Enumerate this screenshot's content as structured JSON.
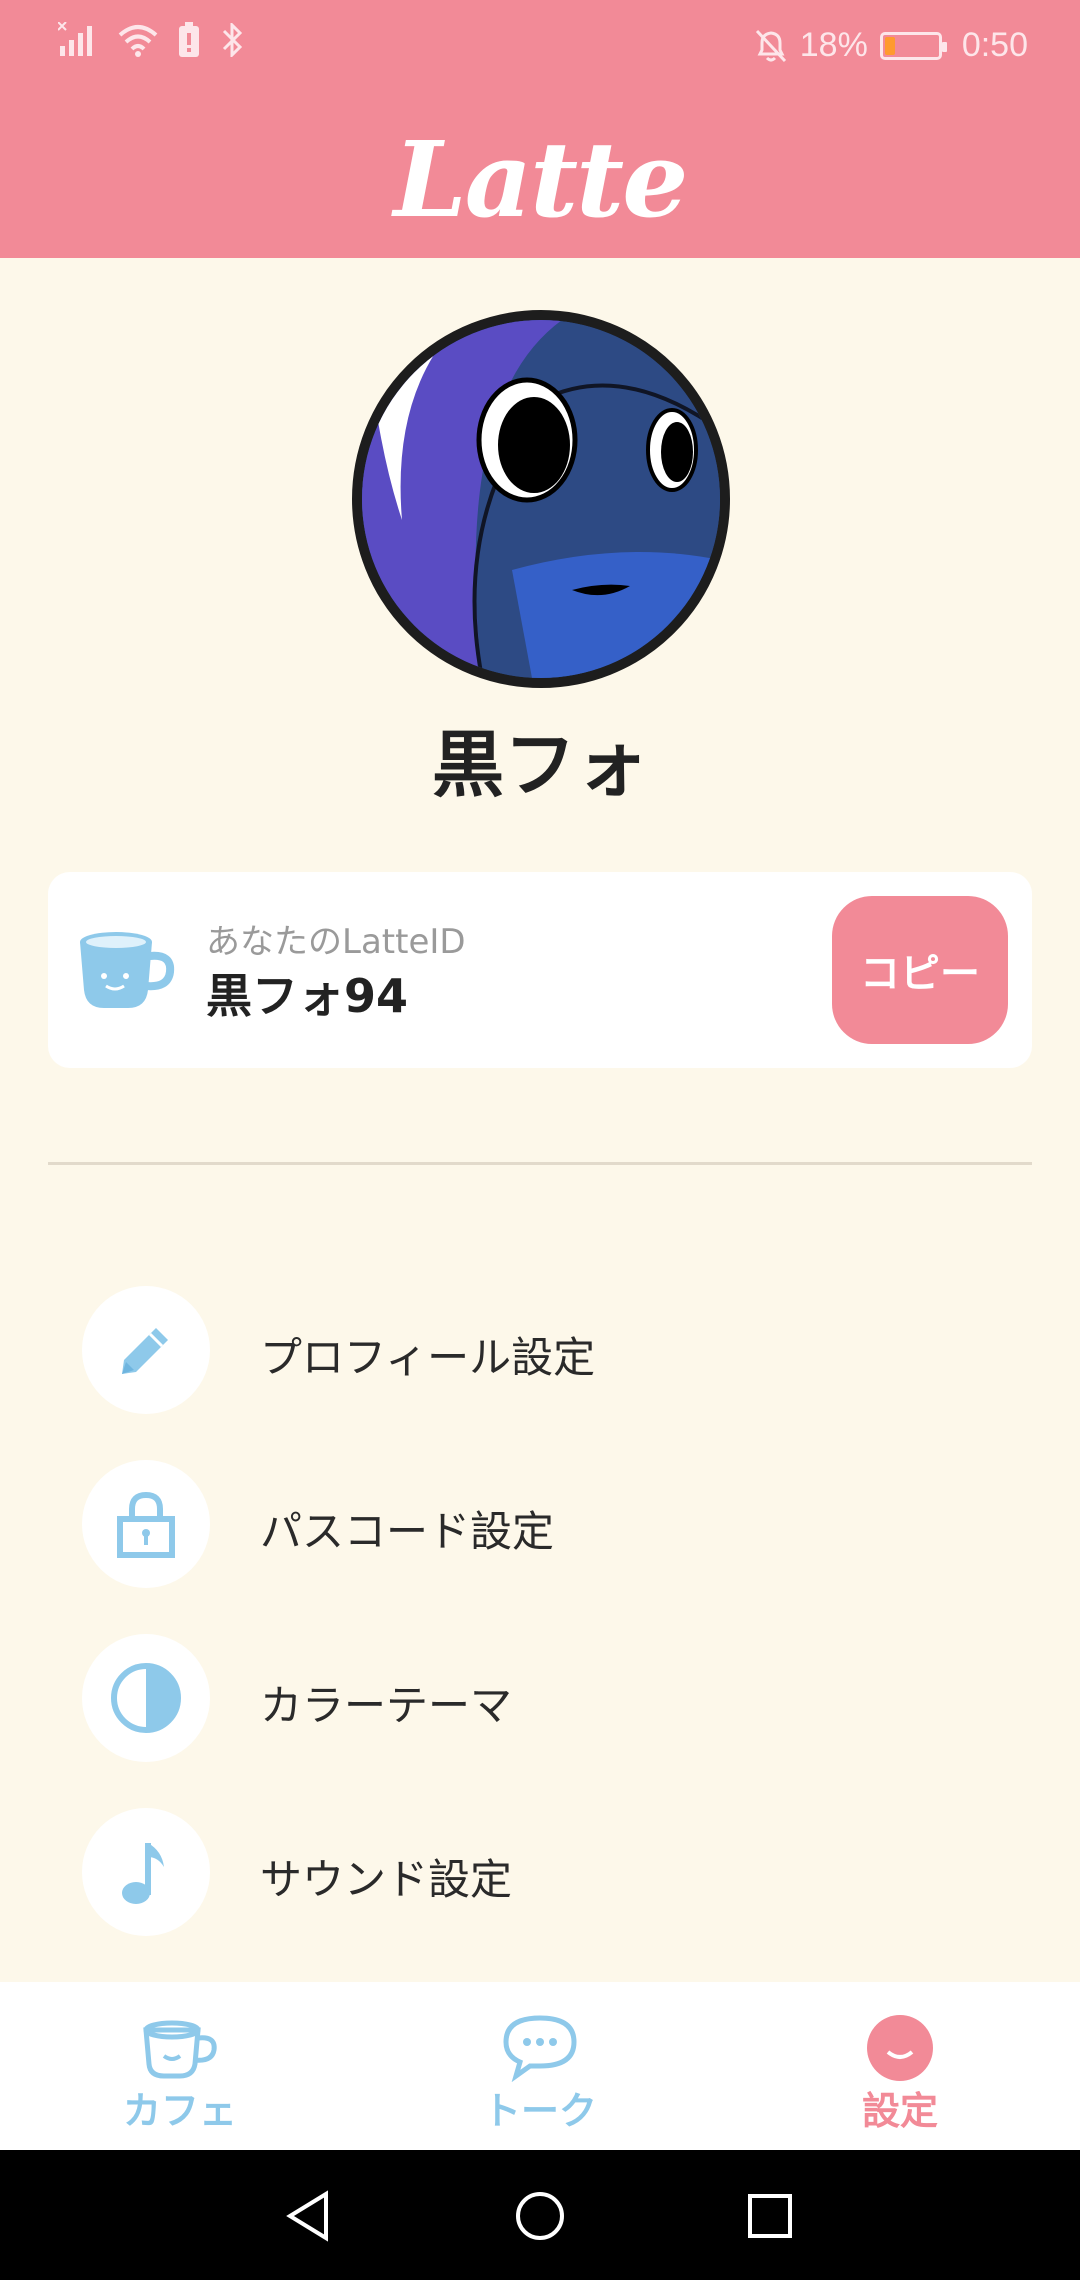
{
  "status_bar": {
    "battery_percent": "18%",
    "time": "0:50"
  },
  "app": {
    "logo_text": "Latte"
  },
  "profile": {
    "username": "黒フォ"
  },
  "id_card": {
    "label": "あなたのLatteID",
    "value": "黒フォ94",
    "copy_label": "コピー"
  },
  "menu": {
    "items": [
      {
        "label": "プロフィール設定",
        "icon": "pencil-icon"
      },
      {
        "label": "パスコード設定",
        "icon": "lock-icon"
      },
      {
        "label": "カラーテーマ",
        "icon": "half-circle-icon"
      },
      {
        "label": "サウンド設定",
        "icon": "music-note-icon"
      }
    ]
  },
  "bottom_nav": {
    "items": [
      {
        "label": "カフェ",
        "icon": "cup-icon",
        "active": false
      },
      {
        "label": "トーク",
        "icon": "chat-bubble-icon",
        "active": false
      },
      {
        "label": "設定",
        "icon": "smiley-icon",
        "active": true
      }
    ]
  },
  "colors": {
    "header": "#f28a97",
    "background": "#fdf8ea",
    "accent_blue": "#8ec9ea",
    "accent_pink": "#f28a97"
  }
}
